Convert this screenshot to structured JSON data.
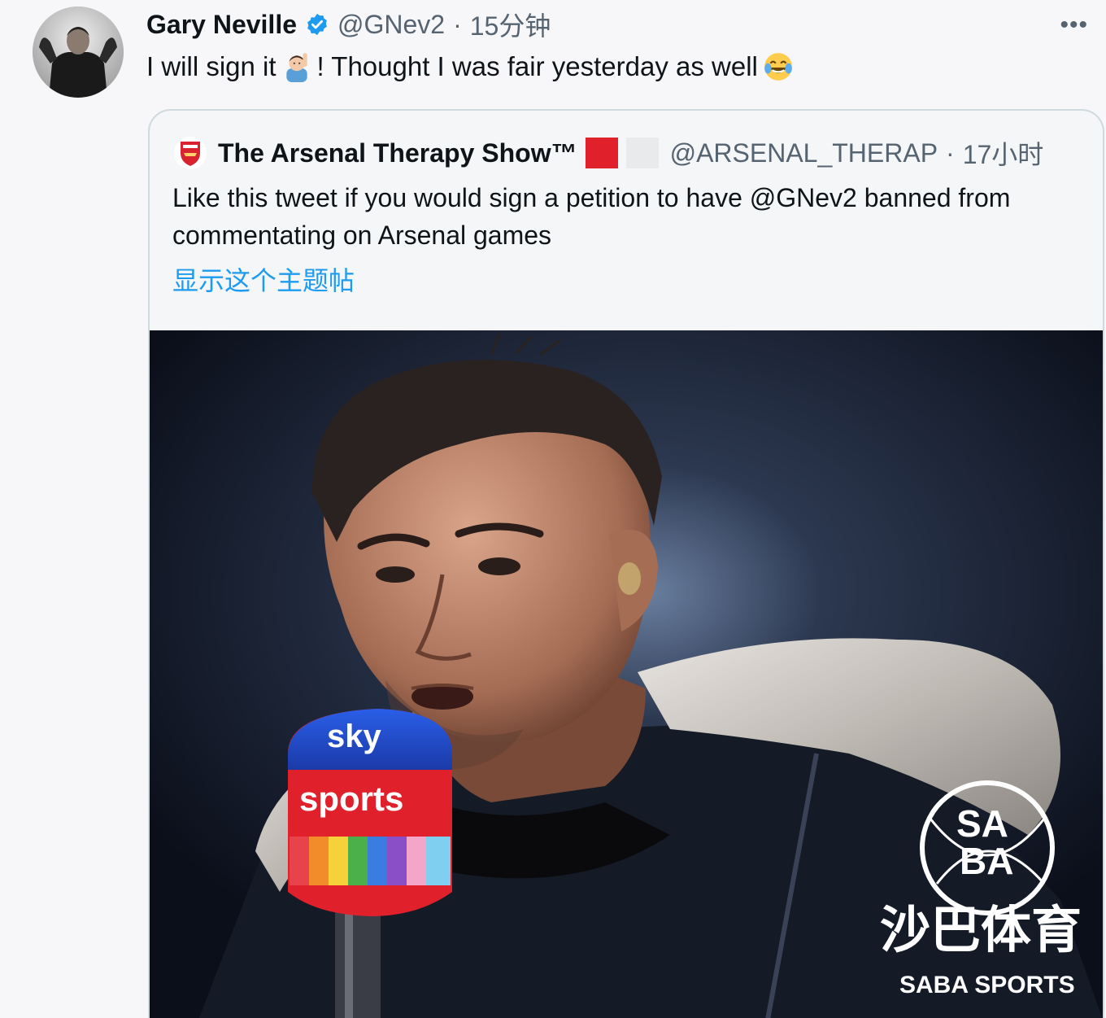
{
  "tweet": {
    "display_name": "Gary Neville",
    "handle": "@GNev2",
    "separator": "·",
    "timestamp": "15分钟",
    "text_part1": "I will sign it",
    "text_part2": "! Thought I was fair yesterday as well",
    "more_label": "•••"
  },
  "quote": {
    "display_name": "The Arsenal Therapy Show™",
    "handle": "@ARSENAL_THERAP",
    "separator": "·",
    "timestamp": "17小时",
    "text": "Like this tweet if you would sign a petition to have @GNev2 banned from commentating on Arsenal games",
    "show_thread_label": "显示这个主题帖"
  },
  "photo": {
    "mic_brand_top": "sky",
    "mic_brand_bottom": "sports",
    "watermark_cn": "沙巴体育",
    "watermark_en": "SABA SPORTS",
    "watermark_logo_top": "SA",
    "watermark_logo_bottom": "BA"
  },
  "colors": {
    "link": "#1d9bf0",
    "verified": "#1d9bf0",
    "muted": "#566370",
    "mic_red": "#e0212b",
    "mic_blue": "#1e49c8"
  }
}
